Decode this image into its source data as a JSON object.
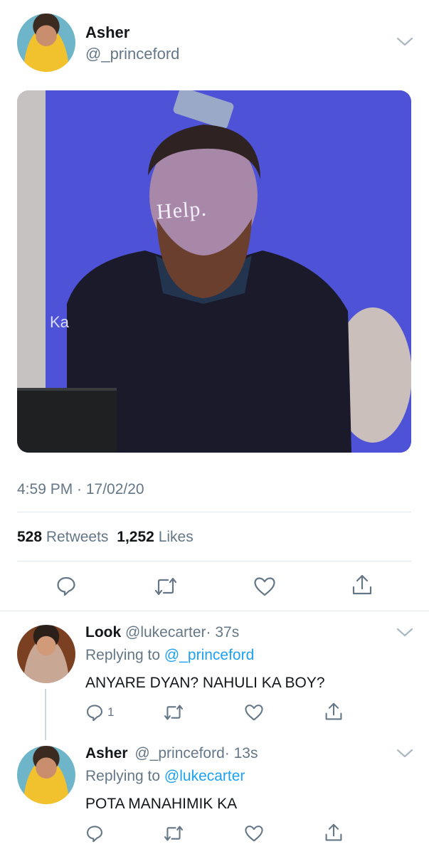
{
  "tweet": {
    "author_name": "Asher",
    "author_handle": "@_princeford",
    "image_text": "Help.",
    "timestamp": "4:59 PM · 17/02/20",
    "retweets_count": "528",
    "retweets_label": "Retweets",
    "likes_count": "1,252",
    "likes_label": "Likes"
  },
  "replies": [
    {
      "name": "Look",
      "handle": "@lukecarter",
      "time": "· 37s",
      "replying_prefix": "Replying to",
      "replying_to": "@_princeford",
      "text": "ANYARE DYAN? NAHULI KA BOY?",
      "reply_count": "1"
    },
    {
      "name": "Asher",
      "handle": "@_princeford",
      "time": "· 13s",
      "replying_prefix": "Replying to",
      "replying_to": "@lukecarter",
      "text": "POTA MANAHIMIK KA",
      "reply_count": ""
    }
  ],
  "icons": {
    "reply": "reply-icon",
    "retweet": "retweet-icon",
    "like": "heart-icon",
    "share": "share-icon",
    "more": "chevron-down-icon"
  },
  "colors": {
    "link": "#1da1f2",
    "secondary_text": "#657786",
    "icon": "#657786"
  }
}
